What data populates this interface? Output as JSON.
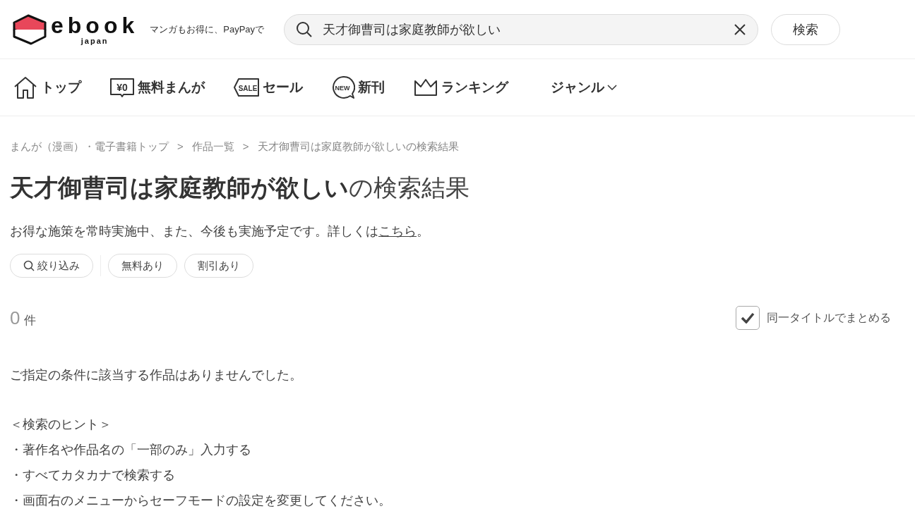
{
  "header": {
    "logo": {
      "wordmark": "ebook",
      "sub": "japan"
    },
    "tagline": "マンガもお得に、PayPayで",
    "search": {
      "value": "天才御曹司は家庭教師が欲しい"
    },
    "search_button": "検索"
  },
  "nav": [
    {
      "kind": "home",
      "label": "トップ"
    },
    {
      "kind": "free",
      "label": "無料まんが",
      "icon_text": "¥0"
    },
    {
      "kind": "sale",
      "label": "セール",
      "icon_text": "SALE"
    },
    {
      "kind": "new",
      "label": "新刊",
      "icon_text": "NEW"
    },
    {
      "kind": "ranking",
      "label": "ランキング"
    },
    {
      "kind": "genre",
      "label": "ジャンル"
    }
  ],
  "breadcrumbs": [
    "まんが（漫画）・電子書籍トップ",
    "作品一覧",
    "天才御曹司は家庭教師が欲しいの検索結果"
  ],
  "breadcrumb_separator": ">",
  "heading": "**天才御曹司は家庭教師が欲しい**の検索結果",
  "notice": {
    "text": "お得な施策を常時実施中、また、今後も実施予定です。詳しくは",
    "link": "こちら",
    "end": "。"
  },
  "filters": [
    {
      "kind": "search",
      "label": "絞り込み"
    },
    {
      "kind": "chip",
      "label": "無料あり"
    },
    {
      "kind": "chip",
      "label": "割引あり"
    }
  ],
  "result_count": {
    "number": "0",
    "unit": "件"
  },
  "group_titles": {
    "label": "同一タイトルでまとめる",
    "checked": true
  },
  "empty_message": "ご指定の条件に該当する作品はありませんでした。",
  "hints": [
    "＜検索のヒント＞",
    "・著作名や作品名の「一部のみ」入力する",
    "・すべてカタカナで検索する",
    "・画面右のメニューからセーフモードの設定を変更してください。"
  ]
}
